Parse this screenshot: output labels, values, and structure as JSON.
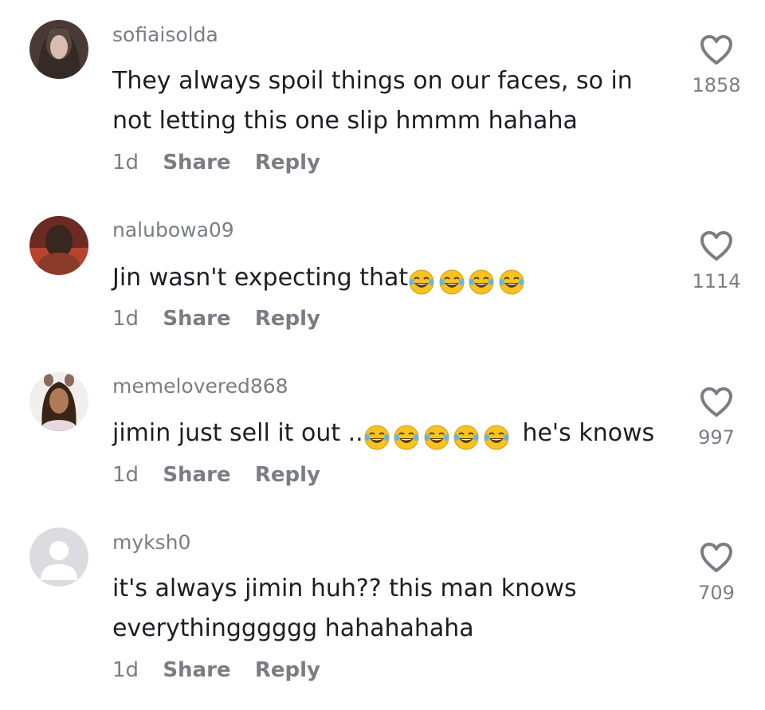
{
  "comments": [
    {
      "username": "sofiaisolda",
      "text": "They always spoil things on our faces, so in not letting this one slip hmmm hahaha",
      "after_text": "",
      "emoji_count": 0,
      "age": "1d",
      "share_label": "Share",
      "reply_label": "Reply",
      "likes": "1858",
      "avatar": "photo-avatar"
    },
    {
      "username": "nalubowa09",
      "text": "Jin wasn't expecting that",
      "after_text": "",
      "emoji_count": 4,
      "emoji": "face-with-tears-of-joy",
      "age": "1d",
      "share_label": "Share",
      "reply_label": "Reply",
      "likes": "1114",
      "avatar": "photo-avatar"
    },
    {
      "username": "memelovered868",
      "text": "jimin just sell it out ..",
      "after_text": " he's knows",
      "emoji_count": 5,
      "emoji": "face-with-tears-of-joy",
      "age": "1d",
      "share_label": "Share",
      "reply_label": "Reply",
      "likes": "997",
      "avatar": "photo-avatar"
    },
    {
      "username": "myksh0",
      "text": "it's always jimin huh?? this man knows everythingggggg hahahahaha",
      "after_text": "",
      "emoji_count": 0,
      "age": "1d",
      "share_label": "Share",
      "reply_label": "Reply",
      "likes": "709",
      "avatar": "default-person-avatar"
    }
  ],
  "colors": {
    "username": "#7b7d84",
    "text": "#1d1e23",
    "meta": "#7b7d84",
    "heart_stroke": "#7b7d84",
    "emoji_face": "#f7c31f"
  }
}
